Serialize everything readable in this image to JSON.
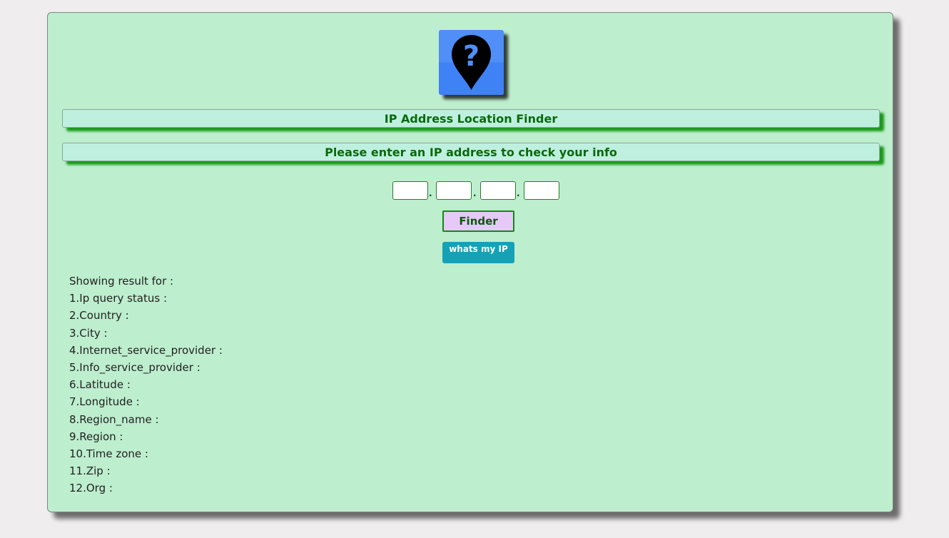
{
  "header": {
    "logo_icon": "location-pin-question-icon",
    "title": "IP Address Location Finder",
    "prompt": "Please enter an IP address to check your info"
  },
  "ip_input": {
    "octets": [
      {
        "value": "",
        "placeholder": ""
      },
      {
        "value": "",
        "placeholder": ""
      },
      {
        "value": "",
        "placeholder": ""
      },
      {
        "value": "",
        "placeholder": ""
      }
    ],
    "separator": "."
  },
  "buttons": {
    "finder_label": "Finder",
    "whats_my_ip_label": "whats my IP"
  },
  "results": {
    "heading": "Showing result for :",
    "fields": [
      "1.Ip query status :",
      "2.Country :",
      "3.City :",
      "4.Internet_service_provider :",
      "5.Info_service_provider :",
      "6.Latitude :",
      "7.Longitude :",
      "8.Region_name :",
      "9.Region :",
      "10.Time zone :",
      "11.Zip :",
      "12.Org :"
    ]
  },
  "colors": {
    "page_background": "#efedee",
    "card_background": "#bdeece",
    "banner_background": "#bff0df",
    "banner_text": "#0a6a0a",
    "banner_shadow": "#1a9a1a",
    "finder_background": "#e6c9f9",
    "whats_my_ip_background": "#16a2b6",
    "logo_blue": "#4f8ff7"
  }
}
